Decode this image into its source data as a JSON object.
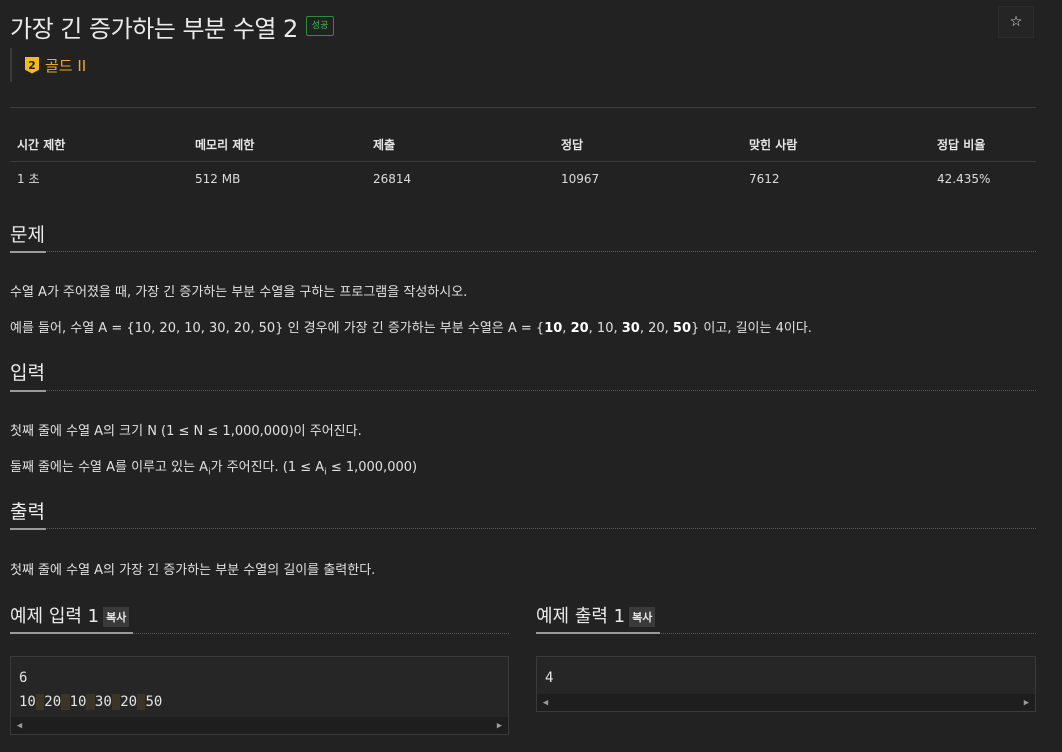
{
  "problem": {
    "title": "가장 긴 증가하는 부분 수열 2",
    "result_badge": "성공",
    "star_icon": "☆",
    "tier_number": "2",
    "tier_label": "골드 II"
  },
  "info_table": {
    "headers": [
      "시간 제한",
      "메모리 제한",
      "제출",
      "정답",
      "맞힌 사람",
      "정답 비율"
    ],
    "values": [
      "1 초",
      "512 MB",
      "26814",
      "10967",
      "7612",
      "42.435%"
    ]
  },
  "sections": {
    "problem": {
      "heading": "문제",
      "line1": "수열 A가 주어졌을 때, 가장 긴 증가하는 부분 수열을 구하는 프로그램을 작성하시오.",
      "line2_pre": "예를 들어, 수열 A = {10, 20, 10, 30, 20, 50} 인 경우에 가장 긴 증가하는 부분 수열은 A = {",
      "line2_b1": "10",
      "line2_s1": ", ",
      "line2_b2": "20",
      "line2_s2": ", 10, ",
      "line2_b3": "30",
      "line2_s3": ", 20, ",
      "line2_b4": "50",
      "line2_post": "} 이고, 길이는 4이다."
    },
    "input": {
      "heading": "입력",
      "line1": "첫째 줄에 수열 A의 크기 N (1 ≤ N ≤ 1,000,000)이 주어진다.",
      "line2_pre": "둘째 줄에는 수열 A를 이루고 있는 A",
      "line2_sub": "i",
      "line2_mid": "가 주어진다. (1 ≤ A",
      "line2_sub2": "i",
      "line2_post": " ≤ 1,000,000)"
    },
    "output": {
      "heading": "출력",
      "line1": "첫째 줄에 수열 A의 가장 긴 증가하는 부분 수열의 길이를 출력한다."
    }
  },
  "samples": {
    "copy_label": "복사",
    "input": {
      "heading": "예제 입력 1",
      "line1": "6",
      "tokens": [
        "10",
        "20",
        "10",
        "30",
        "20",
        "50"
      ]
    },
    "output": {
      "heading": "예제 출력 1",
      "line1": "4"
    },
    "scroll_left": "◀",
    "scroll_right": "▶"
  }
}
